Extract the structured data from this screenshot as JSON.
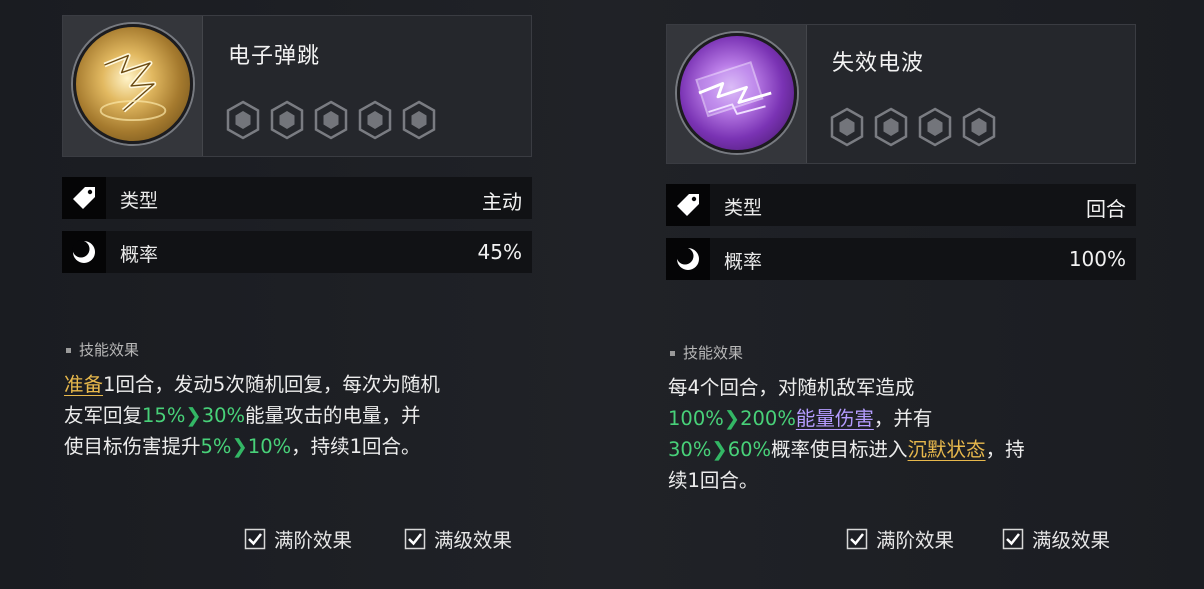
{
  "cards": [
    {
      "name": "电子弹跳",
      "icon": "lightning-orb-gold",
      "max_level": 5,
      "type_label": "类型",
      "type_value": "主动",
      "prob_label": "概率",
      "prob_value": "45%",
      "section_title": "技能效果",
      "desc": {
        "l1_kw": "准备",
        "l1_rest": "1回合，发动5次随机回复，每次为随机",
        "l2_a": "友军回复",
        "l2_v1": "15%",
        "l2_v2": "30%",
        "l2_b": "能量攻击的电量，并",
        "l3_a": "使目标伤害提升",
        "l3_v1": "5%",
        "l3_v2": "10%",
        "l3_b": "，持续1回合。"
      },
      "opt1": "满阶效果",
      "opt2": "满级效果"
    },
    {
      "name": "失效电波",
      "icon": "lightning-orb-purple",
      "max_level": 4,
      "type_label": "类型",
      "type_value": "回合",
      "prob_label": "概率",
      "prob_value": "100%",
      "section_title": "技能效果",
      "desc": {
        "l1": "每4个回合，对随机敌军造成",
        "l2_v1": "100%",
        "l2_v2": "200%",
        "l2_kw": "能量伤害",
        "l2_b": "，并有",
        "l3_v1": "30%",
        "l3_v2": "60%",
        "l3_a": "概率使目标进入",
        "l3_kw": "沉默状态",
        "l3_b": "，持",
        "l4": "续1回合。"
      },
      "opt1": "满阶效果",
      "opt2": "满级效果"
    }
  ],
  "colors": {
    "keyword_gold": "#e7b84c",
    "value_green": "#48d179",
    "keyword_purple": "#b59cff"
  }
}
